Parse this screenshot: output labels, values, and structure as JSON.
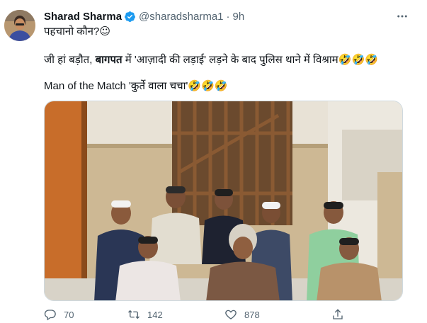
{
  "tweet": {
    "author_name": "Sharad Sharma",
    "handle": "@sharadsharma1",
    "separator": "·",
    "time": "9h",
    "line1": "पहचानो कौन?",
    "line1_emoji": "☺",
    "line2_part1": "जी हां बड़ौत, ",
    "line2_bold": "बागपत",
    "line2_part2": " में 'आज़ादी की लड़ाई' लड़ने के बाद पुलिस थाने में विश्राम",
    "line2_emoji": "🤣🤣🤣",
    "line3": "Man of the Match 'कुर्ते वाला चचा'",
    "line3_emoji": "🤣🤣🤣"
  },
  "actions": {
    "replies": "70",
    "retweets": "142",
    "likes": "878"
  },
  "icons": {
    "verified": "verified-badge-icon",
    "more": "more-options-icon",
    "reply": "reply-icon",
    "retweet": "retweet-icon",
    "like": "heart-icon",
    "share": "share-icon"
  },
  "colors": {
    "verified": "#1d9bf0",
    "secondary_text": "#536471",
    "primary_text": "#0f1419"
  }
}
